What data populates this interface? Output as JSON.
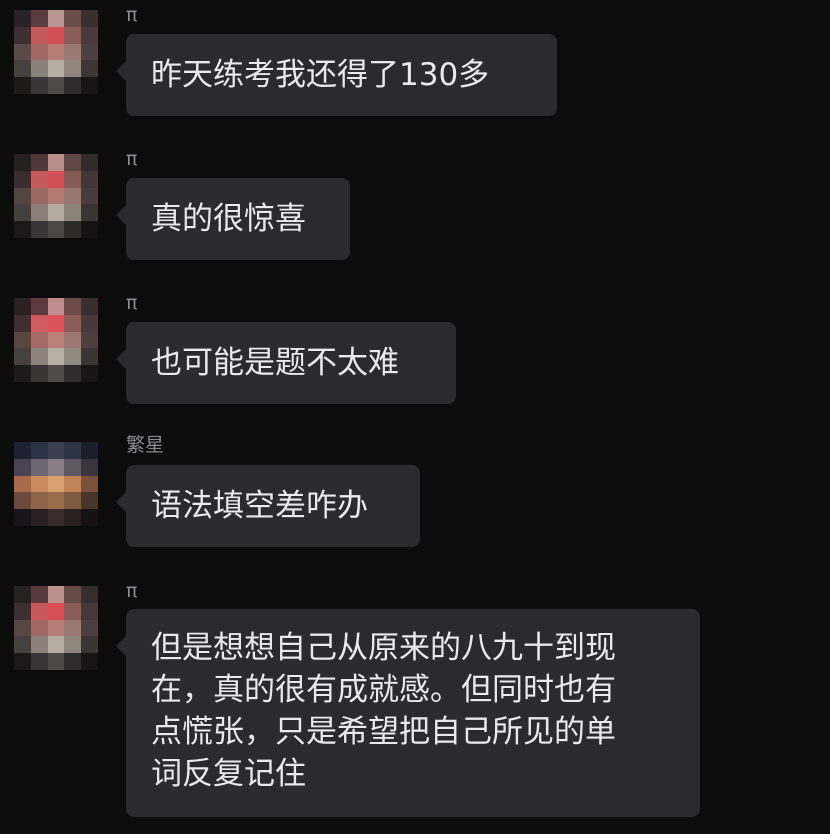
{
  "messages": [
    {
      "sender": "π",
      "text": "昨天练考我还得了130多",
      "avatar_palette": [
        "#2a2226",
        "#5a3c3e",
        "#b9968f",
        "#6b4d4b",
        "#3a2e2f",
        "#3e2f32",
        "#c25a5c",
        "#d24e55",
        "#8b5d58",
        "#4a3a3b",
        "#5a4a47",
        "#a06a62",
        "#b77e75",
        "#9a7b73",
        "#4d3f3e",
        "#46403e",
        "#8a807a",
        "#b7aea4",
        "#8f857c",
        "#3d3634",
        "#1d1a1a",
        "#3a3536",
        "#4f4948",
        "#2f2b2c",
        "#171515"
      ]
    },
    {
      "sender": "π",
      "text": "真的很惊喜",
      "avatar_palette": [
        "#262022",
        "#4f3838",
        "#b88f89",
        "#5e4746",
        "#332a2b",
        "#3b2c30",
        "#c45a5e",
        "#d44e57",
        "#855a55",
        "#433637",
        "#554541",
        "#9b6861",
        "#b27b72",
        "#957770",
        "#4a3c3b",
        "#45403d",
        "#897f78",
        "#b4aba1",
        "#8b827a",
        "#3a3432",
        "#1b1919",
        "#383334",
        "#4c4645",
        "#2d2a2a",
        "#151313"
      ]
    },
    {
      "sender": "π",
      "text": "也可能是题不太难",
      "avatar_palette": [
        "#2b2124",
        "#5c3a3d",
        "#c18d8c",
        "#6c4a4a",
        "#3a2d2f",
        "#3f2d31",
        "#cf5b61",
        "#dd515b",
        "#8c5c58",
        "#493839",
        "#584641",
        "#a46a63",
        "#ba7f77",
        "#9c7a73",
        "#4e3f3d",
        "#47413e",
        "#8d827c",
        "#b8afa5",
        "#918880",
        "#3c3533",
        "#1e1a1b",
        "#3b3536",
        "#504a48",
        "#302c2d",
        "#181616"
      ]
    },
    {
      "sender": "繁星",
      "text": "语法填空差咋办",
      "avatar_palette": [
        "#1c2231",
        "#2b3446",
        "#3a3f52",
        "#2d3444",
        "#1a1f2c",
        "#4a4452",
        "#6c6670",
        "#8a7e86",
        "#5e5862",
        "#3a3640",
        "#a86a4a",
        "#c98a5e",
        "#d9a070",
        "#c08456",
        "#7a5038",
        "#6a4a3a",
        "#8c6448",
        "#9a6e4c",
        "#7e5a40",
        "#4a3428",
        "#1a1418",
        "#2a2024",
        "#3a2c2c",
        "#2a2022",
        "#161214"
      ]
    },
    {
      "sender": "π",
      "text": "但是想想自己从原来的八九十到现在，真的很有成就感。但同时也有点慌张，只是希望把自己所见的单词反复记住",
      "avatar_palette": [
        "#282124",
        "#593b3d",
        "#bd918b",
        "#674b49",
        "#372d2e",
        "#3d2e31",
        "#c9585c",
        "#d84d56",
        "#895c57",
        "#463839",
        "#574641",
        "#a06962",
        "#b67e76",
        "#997a72",
        "#4b3e3c",
        "#46403e",
        "#8b817a",
        "#b6ada3",
        "#8e857d",
        "#3b3533",
        "#1c191a",
        "#393435",
        "#4e4847",
        "#2e2b2c",
        "#161414"
      ]
    }
  ],
  "layout_lines": [
    "但是想想自己从原来的八九十到现",
    "在，真的很有成就感。但同时也有",
    "点慌张，只是希望把自己所见的单",
    "词反复记住"
  ]
}
